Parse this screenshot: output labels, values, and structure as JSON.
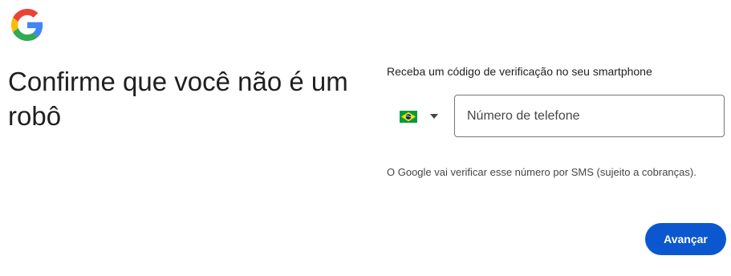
{
  "header": {
    "logo_icon": "google-g-logo-icon"
  },
  "main": {
    "title": "Confirme que você não é um robô"
  },
  "verification": {
    "instruction": "Receba um código de verificação no seu smartphone",
    "country": {
      "flag_icon": "brazil-flag-icon",
      "dropdown_icon": "caret-down-icon"
    },
    "phone_input": {
      "placeholder": "Número de telefone",
      "value": ""
    },
    "note": "O Google vai verificar esse número por SMS (sujeito a cobranças).",
    "next_label": "Avançar"
  },
  "colors": {
    "primary_button": "#0b57d0",
    "text": "#1f1f1f",
    "secondary_text": "#444746",
    "field_border": "#747775"
  }
}
